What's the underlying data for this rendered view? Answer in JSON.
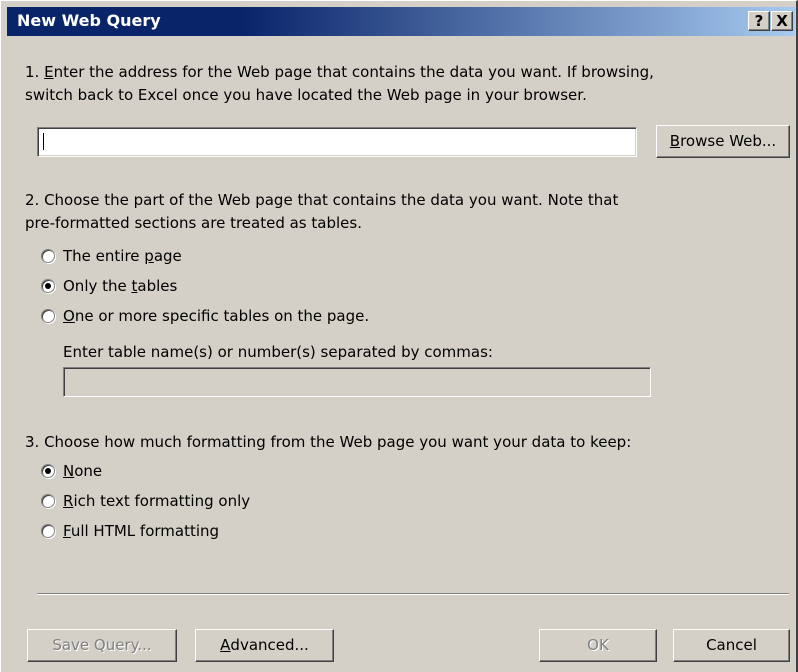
{
  "window": {
    "title": "New Web Query",
    "help_label": "?",
    "close_label": "X"
  },
  "step1": {
    "line1_prefix": "1. ",
    "line1_access": "E",
    "line1_rest": "nter the address for the Web page that contains the data you want.  If browsing,",
    "line2": "switch back to Excel once you have located the Web page in your browser.",
    "address_value": "",
    "browse_button": {
      "access": "B",
      "rest": "rowse Web..."
    }
  },
  "step2": {
    "line1": "2. Choose the part of the Web page that contains the data you want.  Note that",
    "line2": "pre-formatted sections are treated as tables.",
    "options": [
      {
        "pre": "The entire ",
        "access": "p",
        "post": "age",
        "selected": false
      },
      {
        "pre": "Only the ",
        "access": "t",
        "post": "ables",
        "selected": true
      },
      {
        "pre": "",
        "access": "O",
        "post": "ne or more specific tables on the page.",
        "selected": false
      }
    ],
    "tables_label": "Enter table name(s) or number(s) separated by commas:",
    "tables_value": ""
  },
  "step3": {
    "line1": "3. Choose how much formatting from the Web page you want your data to keep:",
    "options": [
      {
        "pre": "",
        "access": "N",
        "post": "one",
        "selected": true
      },
      {
        "pre": "",
        "access": "R",
        "post": "ich text formatting only",
        "selected": false
      },
      {
        "pre": "",
        "access": "F",
        "post": "ull HTML formatting",
        "selected": false
      }
    ]
  },
  "buttons": {
    "save_query": "Save Query...",
    "advanced": {
      "access": "A",
      "rest": "dvanced..."
    },
    "ok": "OK",
    "cancel": "Cancel"
  }
}
